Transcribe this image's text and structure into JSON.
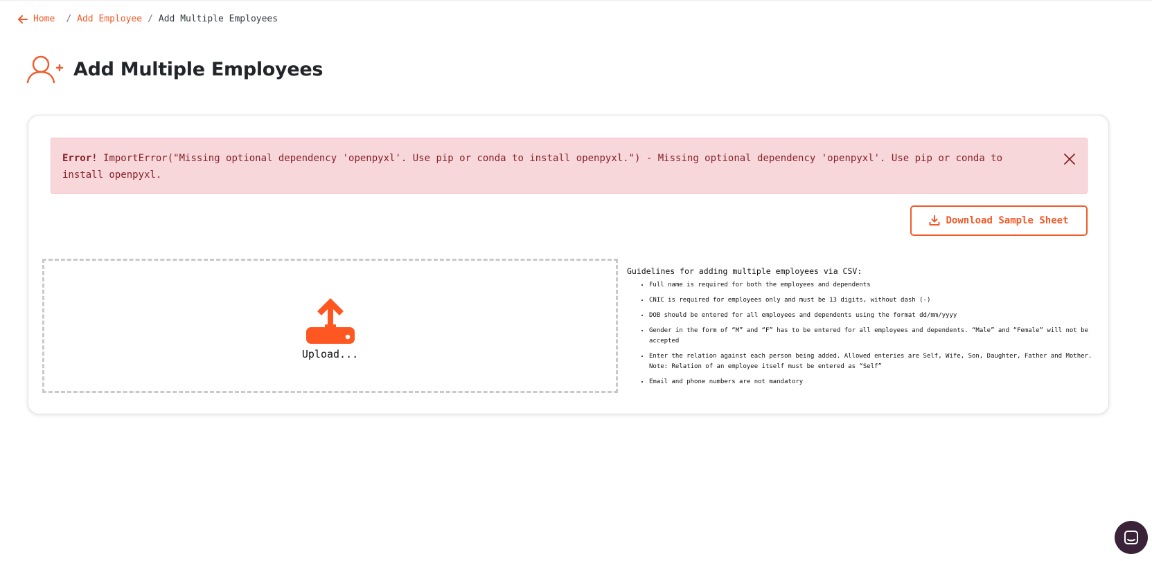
{
  "breadcrumb": {
    "home": "Home",
    "add_employee": "Add Employee",
    "current": "Add Multiple Employees",
    "separator": "/"
  },
  "page": {
    "title": "Add Multiple Employees",
    "icon": "add-user-icon"
  },
  "alert": {
    "label": "Error!",
    "message": "ImportError(\"Missing optional dependency 'openpyxl'. Use pip or conda to install openpyxl.\") - Missing optional dependency 'openpyxl'. Use pip or conda to install openpyxl.",
    "close_icon": "close-icon"
  },
  "actions": {
    "download_label": "Download Sample Sheet",
    "download_icon": "download-icon"
  },
  "upload": {
    "label": "Upload...",
    "icon": "upload-icon"
  },
  "guidelines": {
    "title": "Guidelines for adding multiple employees via CSV:",
    "items": [
      "Full name is required for both the employees and dependents",
      "CNIC is required for employees only and must be 13 digits, without dash (-)",
      "DOB should be entered for all employees and dependents using the format dd/mm/yyyy",
      "Gender in the form of “M” and “F” has to be entered for all employees and dependents. “Male” and “Female” will not be accepted",
      "Enter the relation against each person being added. Allowed enteries are Self, Wife, Son, Daughter, Father and Mother. Note: Relation of an employee itself must be entered as “Self”",
      "Email and phone numbers are not mandatory"
    ]
  },
  "colors": {
    "accent": "#f05a28",
    "alert_bg": "#f8d7da",
    "alert_text": "#842029",
    "chat_bg": "#3a2238"
  },
  "chat": {
    "icon": "chat-icon"
  }
}
